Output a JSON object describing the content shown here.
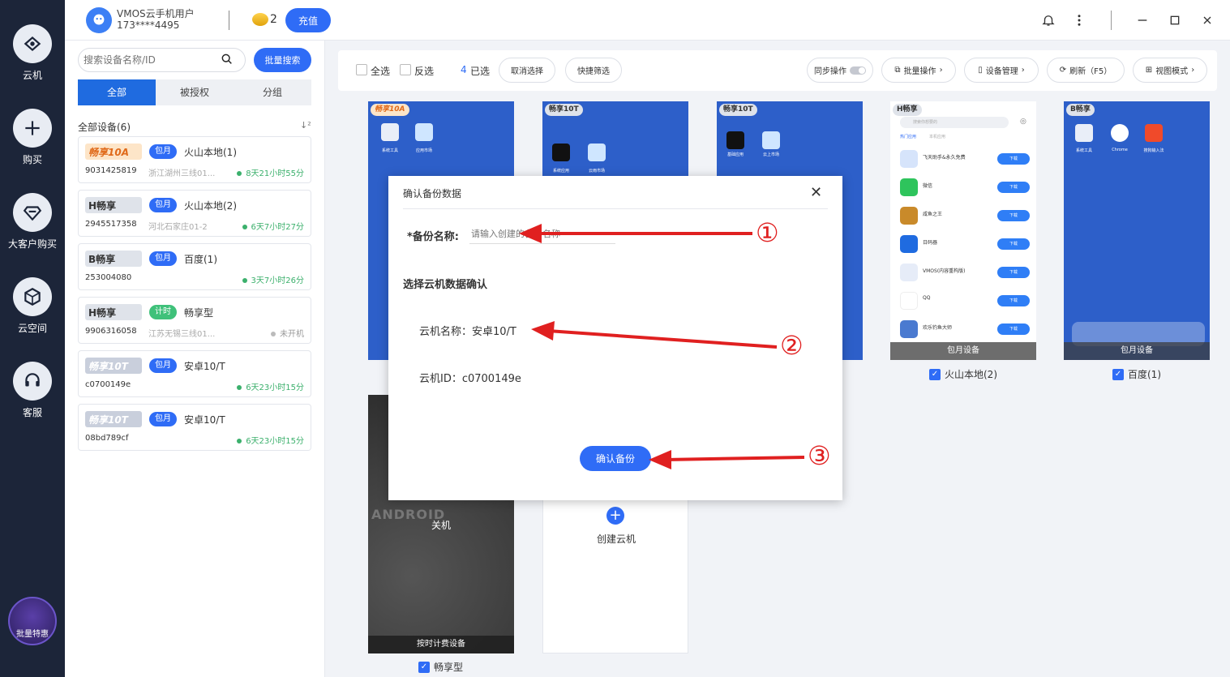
{
  "nav": {
    "items": [
      {
        "label": "云机",
        "icon": "cloud-phone-icon"
      },
      {
        "label": "购买",
        "icon": "plus-icon"
      },
      {
        "label": "大客户购买",
        "icon": "diamond-icon"
      },
      {
        "label": "云空间",
        "icon": "cube-icon"
      },
      {
        "label": "客服",
        "icon": "headset-icon"
      }
    ],
    "logo_text": "批量特惠"
  },
  "header": {
    "user_name": "VMOS云手机用户",
    "user_phone": "173****4495",
    "coins": "2",
    "recharge": "充值"
  },
  "list": {
    "search_placeholder": "搜索设备名称/ID",
    "batch_search": "批量搜索",
    "tabs": [
      "全部",
      "被授权",
      "分组"
    ],
    "all_devices": "全部设备(6)",
    "devices": [
      {
        "badge": "畅享10A",
        "plan": "包月",
        "name": "火山本地(1)",
        "id": "9031425819",
        "location": "浙江湖州三线01...",
        "time": "8天21小时55分"
      },
      {
        "badge": "H畅享",
        "plan": "包月",
        "name": "火山本地(2)",
        "id": "2945517358",
        "location": "河北石家庄01-2",
        "time": "6天7小时27分"
      },
      {
        "badge": "B畅享",
        "plan": "包月",
        "name": "百度(1)",
        "id": "253004080",
        "location": "",
        "time": "3天7小时26分"
      },
      {
        "badge": "H畅享",
        "plan": "计时",
        "name": "畅享型",
        "id": "9906316058",
        "location": "江苏无锡三线01...",
        "time": "未开机"
      },
      {
        "badge": "畅享10T",
        "plan": "包月",
        "name": "安卓10/T",
        "id": "c0700149e",
        "location": "",
        "time": "6天23小时15分"
      },
      {
        "badge": "畅享10T",
        "plan": "包月",
        "name": "安卓10/T",
        "id": "08bd789cf",
        "location": "",
        "time": "6天23小时15分"
      }
    ]
  },
  "toolbar": {
    "select_all": "全选",
    "invert": "反选",
    "selected_count": "4",
    "selected_suffix": "已选",
    "cancel_select": "取消选择",
    "quick_filter": "快捷筛选",
    "sync": "同步操作",
    "batch_ops": "批量操作",
    "device_mgmt": "设备管理",
    "refresh": "刷新（F5）",
    "view_mode": "视图模式"
  },
  "phones": {
    "p1_tag": "畅享10A",
    "p2_tag": "畅享10T",
    "p3_tag": "畅享10T",
    "p4_tag": "H畅享",
    "p4_search": "搜索你想要的",
    "p4_tabs": [
      "热门应用",
      "本机应用"
    ],
    "p4_apps": [
      "飞天助手&永久免费",
      "微信",
      "咸鱼之王",
      "日码器",
      "VMOS(内容重构版)",
      "QQ",
      "欢乐钓鱼大师"
    ],
    "p4_download": "下载",
    "p4_bar": "包月设备",
    "p4_name": "火山本地(2)",
    "p5_tag": "B畅享",
    "p5_apps": [
      "系统工具",
      "Chrome",
      "搜狗输入法"
    ],
    "p5_bar": "包月设备",
    "p5_name": "百度(1)",
    "p1_apps": [
      "系统工具",
      "应用市场"
    ],
    "p2_apps": [
      "系统应用",
      "云雨市场"
    ],
    "p3_apps": [
      "基础应用",
      "云上市场"
    ],
    "p6_status": "关机",
    "p6_bar": "按时计费设备",
    "p6_name": "畅享型",
    "p6_brand": "ANDROID",
    "create": "创建云机"
  },
  "modal": {
    "title": "确认备份数据",
    "backup_label": "*备份名称:",
    "backup_placeholder": "请输入创建的备份名称",
    "section": "选择云机数据确认",
    "cloud_name": "云机名称：安卓10/T",
    "cloud_id": "云机ID：c0700149e",
    "confirm": "确认备份"
  },
  "annotations": [
    "①",
    "②",
    "③"
  ],
  "colors": {
    "accent": "#2f6cf6",
    "nav_bg": "#1c2539",
    "arrow": "#e02020",
    "online": "#3bb06c"
  }
}
